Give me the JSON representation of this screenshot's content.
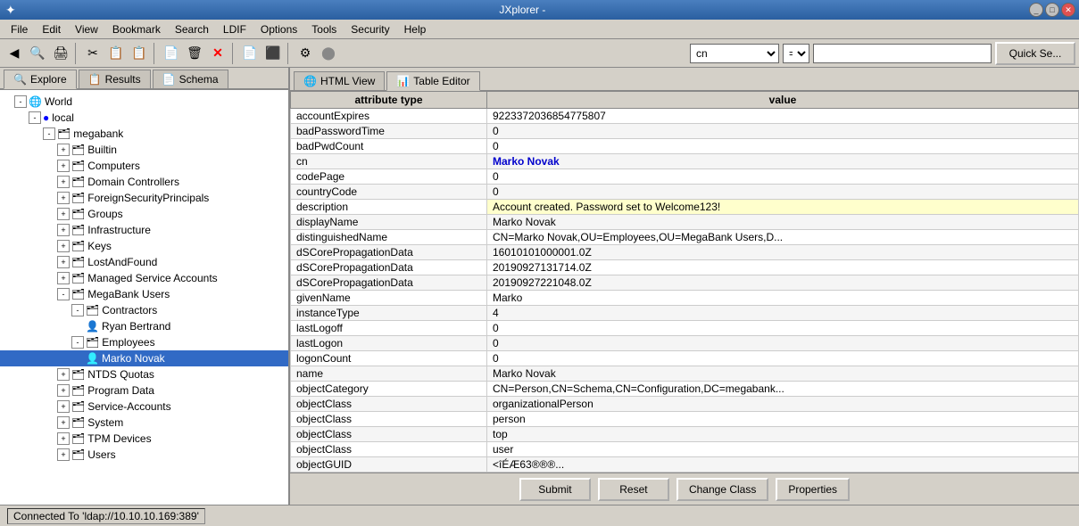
{
  "titlebar": {
    "title": "JXplorer -",
    "app_icon": "✦",
    "minimize_label": "_",
    "maximize_label": "□",
    "close_label": "✕"
  },
  "menubar": {
    "items": [
      "File",
      "Edit",
      "View",
      "Bookmark",
      "Search",
      "LDIF",
      "Options",
      "Tools",
      "Security",
      "Help"
    ]
  },
  "toolbar": {
    "buttons": [
      "⬅",
      "🔍",
      "🖨",
      "✂",
      "📋",
      "📋",
      "📄",
      "🗑",
      "✕",
      "📄",
      "⬛",
      "⚙",
      "⬤"
    ],
    "search_attr": "cn",
    "search_op": "=",
    "search_val": "",
    "quick_search_label": "Quick Se..."
  },
  "explore_tabs": {
    "tabs": [
      {
        "label": "Explore",
        "icon": "🔍",
        "active": true
      },
      {
        "label": "Results",
        "icon": "📋",
        "active": false
      },
      {
        "label": "Schema",
        "icon": "📄",
        "active": false
      }
    ]
  },
  "right_tabs": {
    "tabs": [
      {
        "label": "HTML View",
        "icon": "🌐",
        "active": false
      },
      {
        "label": "Table Editor",
        "icon": "📊",
        "active": true
      }
    ]
  },
  "tree": {
    "world_label": "World",
    "nodes": [
      {
        "id": "world",
        "label": "World",
        "level": 0,
        "type": "globe",
        "expanded": true
      },
      {
        "id": "local",
        "label": "local",
        "level": 1,
        "type": "dot-blue",
        "expanded": true
      },
      {
        "id": "megabank",
        "label": "megabank",
        "level": 2,
        "type": "folder",
        "expanded": true
      },
      {
        "id": "builtin",
        "label": "Builtin",
        "level": 3,
        "type": "folder-ou"
      },
      {
        "id": "computers",
        "label": "Computers",
        "level": 3,
        "type": "folder-ou"
      },
      {
        "id": "domain-controllers",
        "label": "Domain Controllers",
        "level": 3,
        "type": "folder-ou"
      },
      {
        "id": "foreign-principals",
        "label": "ForeignSecurityPrincipals",
        "level": 3,
        "type": "folder-ou"
      },
      {
        "id": "groups",
        "label": "Groups",
        "level": 3,
        "type": "folder-ou"
      },
      {
        "id": "infrastructure",
        "label": "Infrastructure",
        "level": 3,
        "type": "folder-ou"
      },
      {
        "id": "keys",
        "label": "Keys",
        "level": 3,
        "type": "folder-ou"
      },
      {
        "id": "lostfound",
        "label": "LostAndFound",
        "level": 3,
        "type": "folder-ou"
      },
      {
        "id": "managed-service",
        "label": "Managed Service Accounts",
        "level": 3,
        "type": "folder-ou"
      },
      {
        "id": "megabank-users",
        "label": "MegaBank Users",
        "level": 3,
        "type": "folder-ou",
        "expanded": true
      },
      {
        "id": "contractors",
        "label": "Contractors",
        "level": 4,
        "type": "folder-ou",
        "expanded": true
      },
      {
        "id": "ryan-bertrand",
        "label": "Ryan Bertrand",
        "level": 5,
        "type": "user"
      },
      {
        "id": "employees",
        "label": "Employees",
        "level": 4,
        "type": "folder-ou",
        "expanded": true
      },
      {
        "id": "marko-novak",
        "label": "Marko Novak",
        "level": 5,
        "type": "user",
        "selected": true
      },
      {
        "id": "ntds-quotas",
        "label": "NTDS Quotas",
        "level": 3,
        "type": "folder-ou"
      },
      {
        "id": "program-data",
        "label": "Program Data",
        "level": 3,
        "type": "folder-ou"
      },
      {
        "id": "service-accounts",
        "label": "Service-Accounts",
        "level": 3,
        "type": "folder-ou"
      },
      {
        "id": "system",
        "label": "System",
        "level": 3,
        "type": "folder-ou"
      },
      {
        "id": "tpm-devices",
        "label": "TPM Devices",
        "level": 3,
        "type": "folder-ou"
      },
      {
        "id": "users",
        "label": "Users",
        "level": 3,
        "type": "folder-ou"
      }
    ]
  },
  "table": {
    "col_attr": "attribute type",
    "col_val": "value",
    "rows": [
      {
        "attr": "accountExpires",
        "value": "9223372036854775807"
      },
      {
        "attr": "badPasswordTime",
        "value": "0"
      },
      {
        "attr": "badPwdCount",
        "value": "0"
      },
      {
        "attr": "cn",
        "value": "Marko Novak",
        "highlight": "blue"
      },
      {
        "attr": "codePage",
        "value": "0"
      },
      {
        "attr": "countryCode",
        "value": "0"
      },
      {
        "attr": "description",
        "value": "Account created. Password set to Welcome123!",
        "highlight": "yellow"
      },
      {
        "attr": "displayName",
        "value": "Marko Novak"
      },
      {
        "attr": "distinguishedName",
        "value": "CN=Marko Novak,OU=Employees,OU=MegaBank Users,D..."
      },
      {
        "attr": "dSCorePropagationData",
        "value": "16010101000001.0Z"
      },
      {
        "attr": "dSCorePropagationData",
        "value": "20190927131714.0Z"
      },
      {
        "attr": "dSCorePropagationData",
        "value": "20190927221048.0Z"
      },
      {
        "attr": "givenName",
        "value": "Marko"
      },
      {
        "attr": "instanceType",
        "value": "4"
      },
      {
        "attr": "lastLogoff",
        "value": "0"
      },
      {
        "attr": "lastLogon",
        "value": "0"
      },
      {
        "attr": "logonCount",
        "value": "0"
      },
      {
        "attr": "name",
        "value": "Marko Novak"
      },
      {
        "attr": "objectCategory",
        "value": "CN=Person,CN=Schema,CN=Configuration,DC=megabank..."
      },
      {
        "attr": "objectClass",
        "value": "organizationalPerson"
      },
      {
        "attr": "objectClass",
        "value": "person"
      },
      {
        "attr": "objectClass",
        "value": "top"
      },
      {
        "attr": "objectClass",
        "value": "user"
      },
      {
        "attr": "objectGUID",
        "value": "<îÉÆ63®®®..."
      }
    ]
  },
  "buttons": {
    "submit": "Submit",
    "reset": "Reset",
    "change_class": "Change Class",
    "properties": "Properties"
  },
  "statusbar": {
    "text": "Connected To 'ldap://10.10.10.169:389'"
  }
}
